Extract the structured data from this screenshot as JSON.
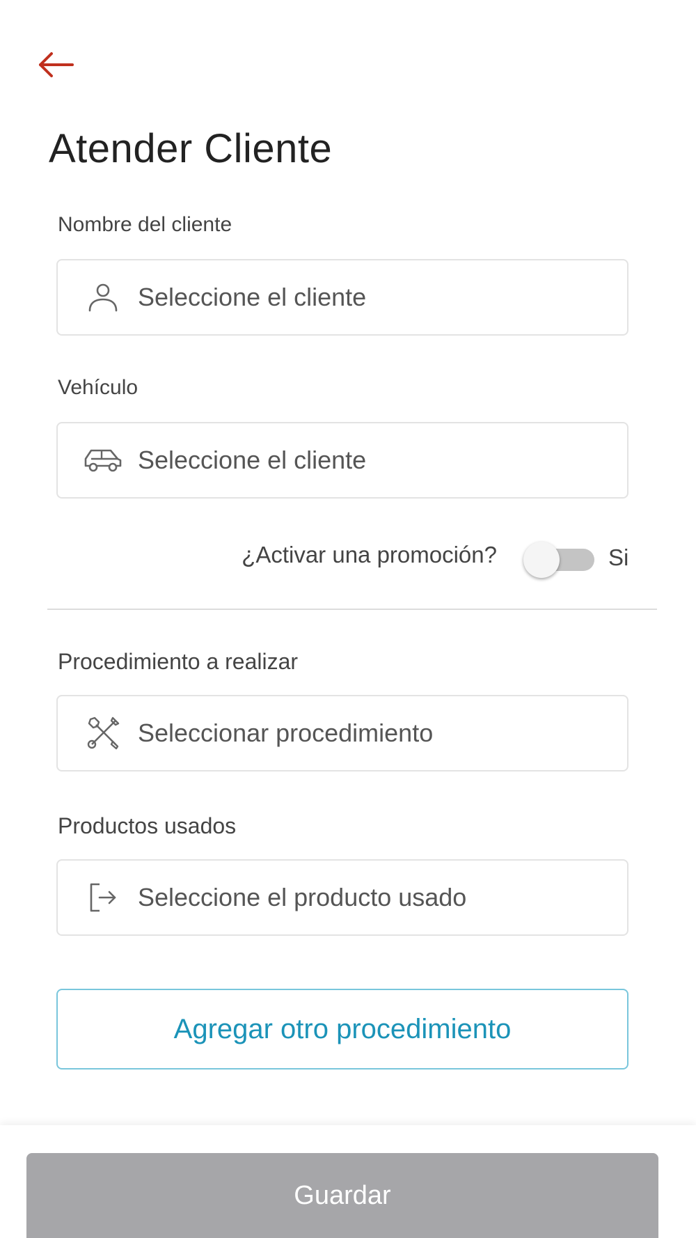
{
  "page": {
    "title": "Atender Cliente"
  },
  "colors": {
    "accent": "#c0301e",
    "link": "#1b93b8",
    "save_button_bg": "#a6a6a9"
  },
  "form": {
    "client": {
      "label": "Nombre del cliente",
      "placeholder": "Seleccione el cliente",
      "icon": "person-icon"
    },
    "vehicle": {
      "label": "Vehículo",
      "placeholder": "Seleccione el cliente",
      "icon": "car-icon"
    },
    "promotion": {
      "label": "¿Activar una promoción?",
      "state_label": "Si",
      "enabled": false
    },
    "procedure": {
      "label": "Procedimiento a realizar",
      "placeholder": "Seleccionar procedimiento",
      "icon": "tools-icon"
    },
    "products": {
      "label": "Productos usados",
      "placeholder": "Seleccione el producto usado",
      "icon": "exit-icon"
    }
  },
  "actions": {
    "add_procedure": "Agregar otro procedimiento",
    "save": "Guardar"
  }
}
